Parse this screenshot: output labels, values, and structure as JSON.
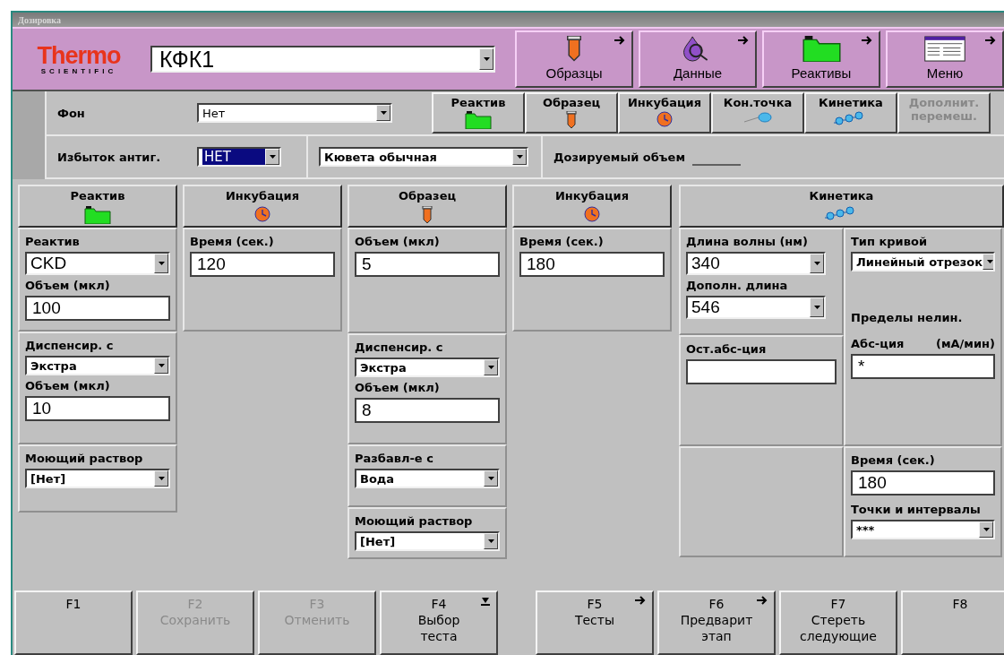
{
  "window": {
    "title": "Дозировка"
  },
  "header": {
    "logo": {
      "brand": "Thermo",
      "sub": "SCIENTIFIC"
    },
    "test_select": {
      "value": "КФК1"
    },
    "nav": [
      {
        "label": "Образцы",
        "kind": "sample"
      },
      {
        "label": "Данные",
        "kind": "data"
      },
      {
        "label": "Реактивы",
        "kind": "reagent"
      },
      {
        "label": "Меню",
        "kind": "menu"
      }
    ]
  },
  "background": {
    "label": "Фон",
    "value": "Нет"
  },
  "steps": [
    {
      "label": "Реактив",
      "kind": "reagent",
      "disabled": false
    },
    {
      "label": "Образец",
      "kind": "sample",
      "disabled": false
    },
    {
      "label": "Инкубация",
      "kind": "clock",
      "disabled": false
    },
    {
      "label": "Кон.точка",
      "kind": "point",
      "disabled": false
    },
    {
      "label": "Кинетика",
      "kind": "kinetics",
      "disabled": false
    },
    {
      "label": "Дополнит.\nперемеш.",
      "disabled": true
    }
  ],
  "antigen": {
    "label": "Избыток антиг.",
    "value": "НЕТ",
    "selected": true
  },
  "cuvette": {
    "value": "Кювета обычная"
  },
  "dose": {
    "label": "Дозируемый объем"
  },
  "panels": [
    {
      "title": "Реактив",
      "kind": "reagent",
      "sections": [
        [
          {
            "kind": "combo",
            "label": "Реактив",
            "value": "CKD"
          },
          {
            "kind": "input",
            "label": "Объем (мкл)",
            "value": "100"
          }
        ],
        [
          {
            "kind": "select",
            "label": "Диспенсир. с",
            "value": "Экстра"
          },
          {
            "kind": "input",
            "label": "Объем (мкл)",
            "value": "10"
          }
        ],
        [
          {
            "kind": "select",
            "label": "Моющий раствор",
            "value": "[Нет]"
          }
        ]
      ]
    },
    {
      "title": "Инкубация",
      "kind": "clock",
      "sections": [
        [
          {
            "kind": "input",
            "label": "Время (сек.)",
            "value": "120"
          }
        ]
      ]
    },
    {
      "title": "Образец",
      "kind": "sample",
      "sections": [
        [
          {
            "kind": "input",
            "label": "Объем (мкл)",
            "value": "5"
          }
        ],
        [
          {
            "kind": "select",
            "label": "Диспенсир. с",
            "value": "Экстра"
          },
          {
            "kind": "input",
            "label": "Объем (мкл)",
            "value": "8"
          }
        ],
        [
          {
            "kind": "select",
            "label": "Разбавл-е с",
            "value": "Вода"
          }
        ],
        [
          {
            "kind": "select",
            "label": "Моющий раствор",
            "value": "[Нет]"
          }
        ]
      ]
    },
    {
      "title": "Инкубация",
      "kind": "clock",
      "sections": [
        [
          {
            "kind": "input",
            "label": "Время (сек.)",
            "value": "180"
          }
        ]
      ]
    }
  ],
  "kinetics": {
    "title": "Кинетика",
    "left": [
      [
        {
          "kind": "combo",
          "label": "Длина волны (нм)",
          "value": "340"
        },
        {
          "kind": "combo",
          "label": "Дополн. длина",
          "value": "546"
        }
      ],
      [
        {
          "kind": "input",
          "label": "Ост.абс-ция"
        }
      ]
    ],
    "right": [
      [
        {
          "kind": "select",
          "label": "Тип кривой",
          "value": "Линейный отрезок"
        },
        {
          "kind": "note",
          "label": "Пределы нелин."
        },
        {
          "kind": "input",
          "label": "Абс-ция",
          "unit": "(мА/мин)",
          "value": "*"
        }
      ],
      [
        {
          "kind": "input",
          "label": "Время (сек.)",
          "value": "180"
        },
        {
          "kind": "select",
          "label": "Точки и интервалы",
          "value": "***"
        }
      ]
    ]
  },
  "fkeys": [
    {
      "key": "F1",
      "disabled": false,
      "arrow": false,
      "dropdown": false
    },
    {
      "key": "F2",
      "label": "Сохранить",
      "disabled": true,
      "arrow": false,
      "dropdown": false
    },
    {
      "key": "F3",
      "label": "Отменить",
      "disabled": true,
      "arrow": false,
      "dropdown": false
    },
    {
      "key": "F4",
      "label": "Выбор\nтеста",
      "disabled": false,
      "arrow": false,
      "dropdown": true
    },
    {
      "key": "F5",
      "label": "Тесты",
      "disabled": false,
      "arrow": true,
      "dropdown": false
    },
    {
      "key": "F6",
      "label": "Предварит\nэтап",
      "disabled": false,
      "arrow": true,
      "dropdown": false
    },
    {
      "key": "F7",
      "label": "Стереть\nследующие",
      "disabled": false,
      "arrow": false,
      "dropdown": false
    },
    {
      "key": "F8",
      "disabled": false,
      "arrow": false,
      "dropdown": false
    }
  ]
}
